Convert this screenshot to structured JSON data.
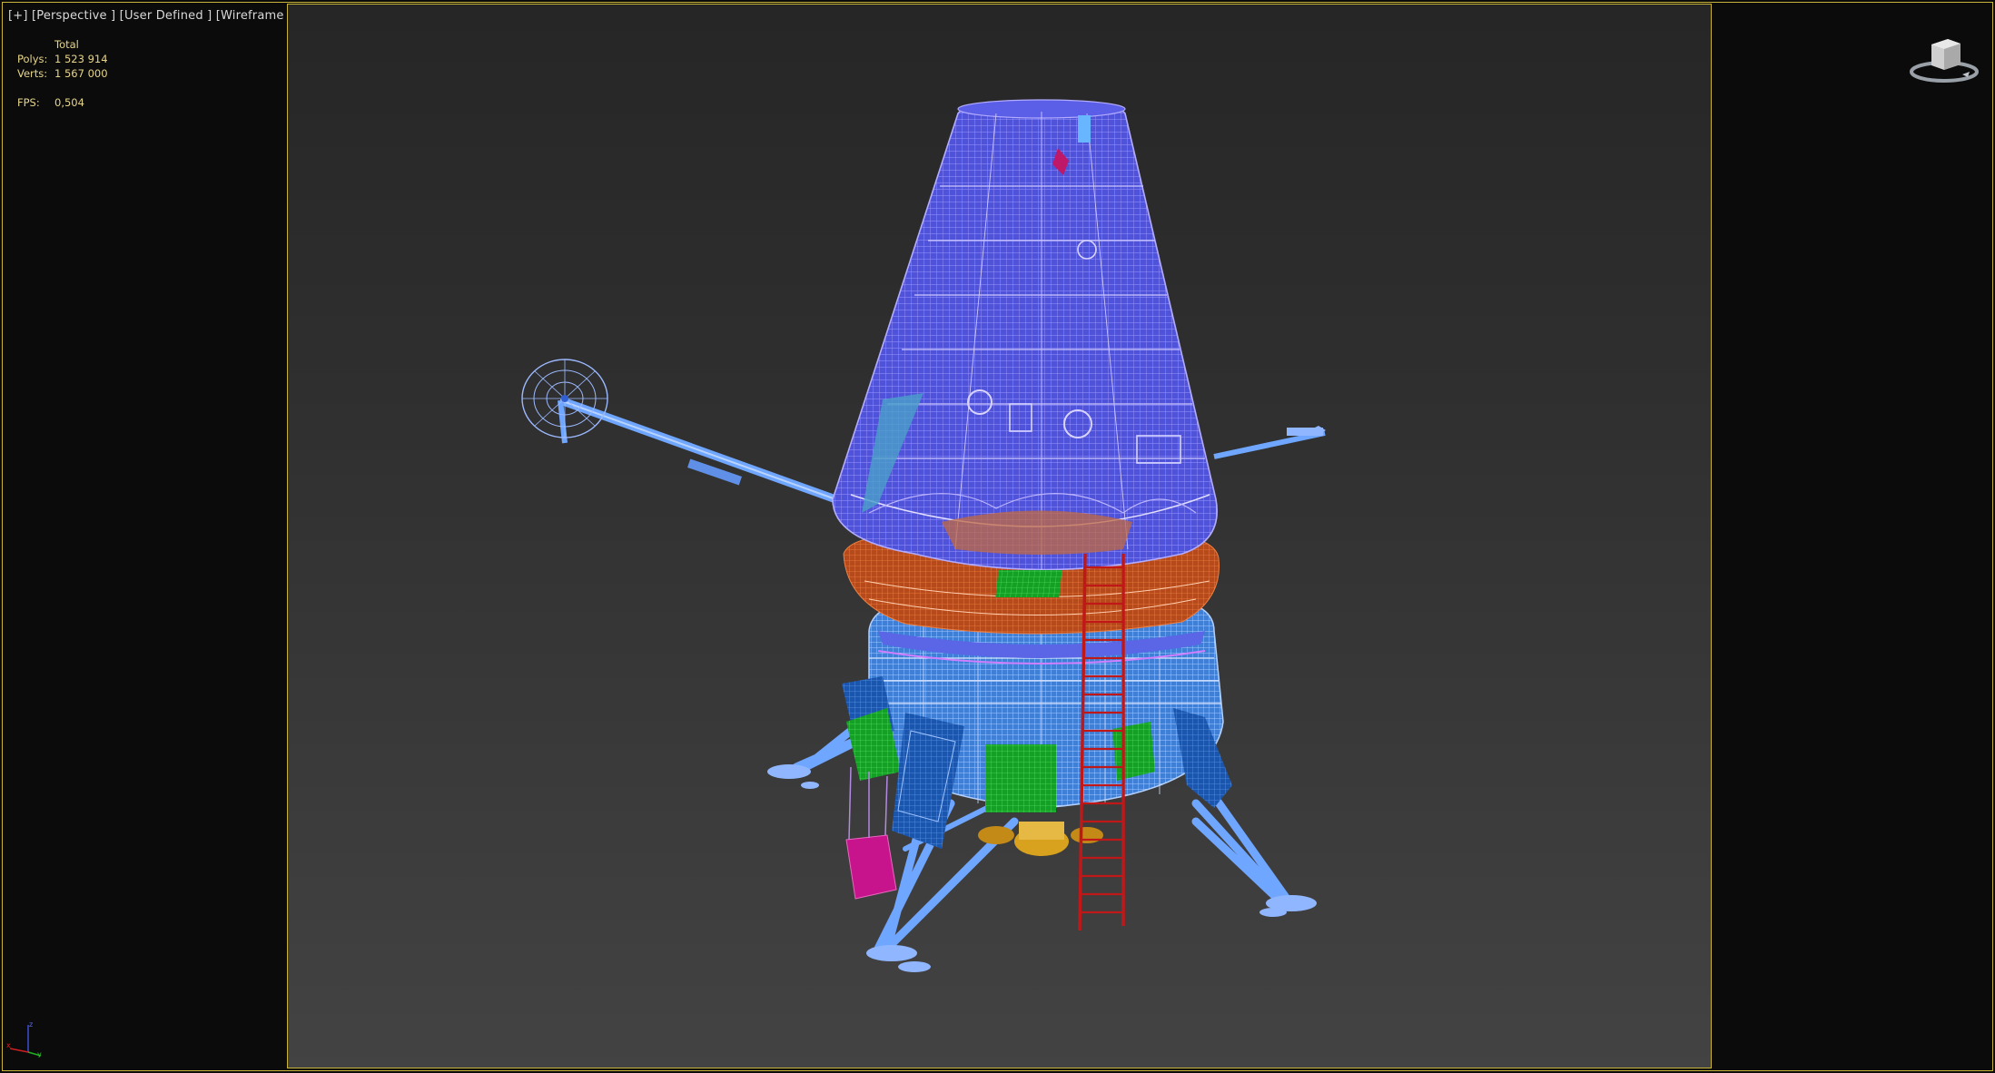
{
  "viewport": {
    "label": "[+] [Perspective ] [User Defined ] [Wireframe ]"
  },
  "stats": {
    "header": "Total",
    "polys_label": "Polys:",
    "polys_value": "1 523 914",
    "verts_label": "Verts:",
    "verts_value": "1 567 000",
    "fps_label": "FPS:",
    "fps_value": "0,504"
  },
  "colors": {
    "frame_border": "#c9b43a",
    "stats_text": "#e6d58a",
    "capsule_wire": "#7a6cff",
    "structure_wire": "#6fa6ff",
    "heat_shield": "#d0531e",
    "ladder": "#c01818",
    "panel_green": "#1aa62a",
    "panel_blue": "#1e5fb6",
    "box_magenta": "#c8148c",
    "engine_gold": "#d8a21e"
  },
  "icons": {
    "viewcube": "viewcube-icon",
    "axis": "axis-tripod-icon"
  }
}
